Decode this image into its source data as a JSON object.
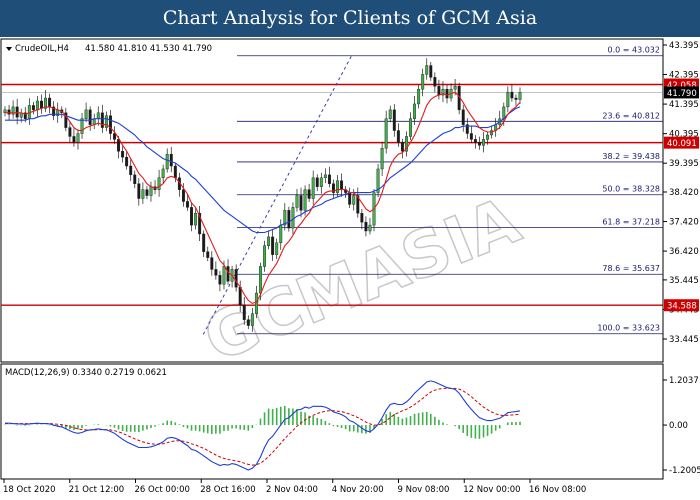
{
  "header": {
    "title": "Chart Analysis for Clients of GCM Asia"
  },
  "watermark": "GCMASIA",
  "colors": {
    "bull": "#3fb04a",
    "bear": "#1a1a1a",
    "ma_fast": "#e21b1b",
    "ma_slow": "#1f3fd6",
    "level": "#cc0000",
    "fib": "#1a1a6e",
    "trend": "#3b3bb0",
    "macd_hist": "#3fb04a",
    "macd_signal": "#cc0000",
    "macd_main": "#1f3fd6"
  },
  "chart_data": [
    {
      "type": "candlestick",
      "title": "CrudeOIL,H4",
      "ohlc_label": "41.580 41.810 41.530 41.790",
      "y_ticks": [
        "43.395",
        "42.395",
        "41.395",
        "40.395",
        "39.395",
        "38.420",
        "37.420",
        "36.420",
        "35.445",
        "34.445",
        "33.445"
      ],
      "y_range": [
        33.445,
        43.395
      ],
      "x_labels": [
        "18 Oct 2020",
        "21 Oct 12:00",
        "26 Oct 00:00",
        "28 Oct 16:00",
        "2 Nov 04:00",
        "4 Nov 20:00",
        "9 Nov 08:00",
        "12 Nov 00:00",
        "16 Nov 08:00"
      ],
      "current_price": "41.790",
      "horizontal_levels": [
        "42.058",
        "40.091",
        "34.588"
      ],
      "fibonacci": [
        {
          "label": "0.0 = 43.032",
          "value": 43.032
        },
        {
          "label": "23.6 = 40.812",
          "value": 40.812
        },
        {
          "label": "38.2 = 39.438",
          "value": 39.438
        },
        {
          "label": "50.0 = 38.328",
          "value": 38.328
        },
        {
          "label": "61.8 = 37.218",
          "value": 37.218
        },
        {
          "label": "78.6 = 35.637",
          "value": 35.637
        },
        {
          "label": "100.0 = 33.623",
          "value": 33.623
        }
      ],
      "trendline": [
        [
          33.6,
          0.385
        ],
        [
          43.1,
          0.675
        ]
      ],
      "closes": [
        41.2,
        41.05,
        41.3,
        40.95,
        41.1,
        40.9,
        41.35,
        41.2,
        41.5,
        41.25,
        41.6,
        41.3,
        41.0,
        41.2,
        41.1,
        40.6,
        40.3,
        40.1,
        40.4,
        40.9,
        41.2,
        40.7,
        40.9,
        41.1,
        40.6,
        41.0,
        40.4,
        40.2,
        39.8,
        39.6,
        39.3,
        39.0,
        38.7,
        38.2,
        38.5,
        38.3,
        38.6,
        38.5,
        38.9,
        39.2,
        39.7,
        39.3,
        38.9,
        38.5,
        38.1,
        37.9,
        37.3,
        37.7,
        37.0,
        36.4,
        36.2,
        35.8,
        35.6,
        35.3,
        35.9,
        35.4,
        35.8,
        35.2,
        34.6,
        34.1,
        33.9,
        34.3,
        35.0,
        35.9,
        36.6,
        36.9,
        36.3,
        36.7,
        37.3,
        37.8,
        37.2,
        37.9,
        38.3,
        37.8,
        38.5,
        38.2,
        38.9,
        38.6,
        38.9,
        39.0,
        38.7,
        38.4,
        38.8,
        38.5,
        38.4,
        38.0,
        38.3,
        37.7,
        37.4,
        37.1,
        37.3,
        38.4,
        39.2,
        39.9,
        40.9,
        41.2,
        40.5,
        40.1,
        39.8,
        40.3,
        40.9,
        41.4,
        41.9,
        42.4,
        42.7,
        42.3,
        42.0,
        41.7,
        41.9,
        41.6,
        41.9,
        42.0,
        41.2,
        40.7,
        40.4,
        40.2,
        40.1,
        40.0,
        40.2,
        40.35,
        40.5,
        40.7,
        40.9,
        41.3,
        41.8,
        41.6,
        41.55,
        41.79
      ],
      "ma_fast": [
        41.1,
        41.1,
        41.1,
        41.1,
        41.1,
        41.05,
        41.1,
        41.15,
        41.2,
        41.25,
        41.3,
        41.3,
        41.25,
        41.2,
        41.15,
        41.0,
        40.8,
        40.6,
        40.5,
        40.5,
        40.6,
        40.65,
        40.7,
        40.75,
        40.7,
        40.7,
        40.6,
        40.45,
        40.25,
        40.0,
        39.8,
        39.55,
        39.3,
        39.05,
        38.9,
        38.7,
        38.6,
        38.55,
        38.6,
        38.7,
        38.9,
        38.95,
        38.9,
        38.75,
        38.55,
        38.35,
        38.05,
        37.9,
        37.6,
        37.3,
        37.0,
        36.7,
        36.4,
        36.1,
        35.95,
        35.7,
        35.6,
        35.4,
        35.2,
        34.95,
        34.75,
        34.65,
        34.7,
        34.95,
        35.3,
        35.6,
        35.8,
        36.0,
        36.3,
        36.6,
        36.75,
        36.95,
        37.2,
        37.35,
        37.55,
        37.7,
        37.95,
        38.1,
        38.25,
        38.4,
        38.45,
        38.45,
        38.5,
        38.5,
        38.5,
        38.4,
        38.4,
        38.25,
        38.05,
        37.85,
        37.75,
        37.85,
        38.05,
        38.4,
        38.85,
        39.3,
        39.55,
        39.7,
        39.75,
        39.9,
        40.1,
        40.35,
        40.65,
        41.0,
        41.35,
        41.55,
        41.65,
        41.7,
        41.75,
        41.7,
        41.75,
        41.8,
        41.65,
        41.45,
        41.2,
        41.0,
        40.8,
        40.6,
        40.5,
        40.45,
        40.45,
        40.5,
        40.6,
        40.8,
        41.05,
        41.2,
        41.3,
        41.45
      ],
      "ma_slow": [
        40.85,
        40.85,
        40.85,
        40.85,
        40.85,
        40.85,
        40.9,
        40.9,
        40.95,
        41.0,
        41.0,
        41.05,
        41.05,
        41.05,
        41.05,
        41.0,
        40.95,
        40.9,
        40.85,
        40.85,
        40.85,
        40.85,
        40.9,
        40.9,
        40.9,
        40.9,
        40.85,
        40.8,
        40.75,
        40.65,
        40.55,
        40.45,
        40.35,
        40.2,
        40.1,
        39.95,
        39.85,
        39.75,
        39.65,
        39.55,
        39.5,
        39.45,
        39.4,
        39.3,
        39.2,
        39.1,
        38.95,
        38.85,
        38.7,
        38.55,
        38.4,
        38.25,
        38.1,
        37.95,
        37.8,
        37.7,
        37.6,
        37.5,
        37.4,
        37.3,
        37.2,
        37.1,
        37.05,
        37.05,
        37.05,
        37.1,
        37.15,
        37.2,
        37.3,
        37.35,
        37.4,
        37.5,
        37.6,
        37.65,
        37.75,
        37.8,
        37.9,
        37.95,
        38.0,
        38.1,
        38.15,
        38.2,
        38.25,
        38.3,
        38.35,
        38.4,
        38.4,
        38.4,
        38.4,
        38.4,
        38.4,
        38.45,
        38.5,
        38.6,
        38.75,
        38.9,
        39.0,
        39.1,
        39.2,
        39.3,
        39.4,
        39.55,
        39.7,
        39.85,
        40.0,
        40.1,
        40.2,
        40.3,
        40.4,
        40.45,
        40.5,
        40.6,
        40.6,
        40.65,
        40.65,
        40.65,
        40.65,
        40.6,
        40.6,
        40.6,
        40.65,
        40.7,
        40.8,
        40.9,
        41.05,
        41.15,
        41.25,
        41.3
      ],
      "x_count": 128
    },
    {
      "type": "macd",
      "title": "MACD(12,26,9) 0.3340 0.2719 0.0621",
      "y_ticks": [
        "1.2037",
        "0.00",
        "-1.2005"
      ],
      "y_range": [
        -1.2005,
        1.2037
      ],
      "macd_line": [
        0.05,
        0.05,
        0.04,
        0.03,
        0.03,
        0.02,
        0.03,
        0.04,
        0.05,
        0.04,
        0.04,
        0.03,
        0.0,
        -0.03,
        -0.05,
        -0.1,
        -0.15,
        -0.2,
        -0.22,
        -0.2,
        -0.15,
        -0.13,
        -0.12,
        -0.1,
        -0.12,
        -0.13,
        -0.17,
        -0.22,
        -0.3,
        -0.38,
        -0.45,
        -0.5,
        -0.55,
        -0.6,
        -0.6,
        -0.6,
        -0.58,
        -0.55,
        -0.5,
        -0.45,
        -0.35,
        -0.33,
        -0.35,
        -0.4,
        -0.48,
        -0.55,
        -0.65,
        -0.68,
        -0.75,
        -0.82,
        -0.9,
        -0.98,
        -1.03,
        -1.08,
        -1.05,
        -1.07,
        -1.03,
        -1.05,
        -1.1,
        -1.15,
        -1.2,
        -1.15,
        -1.05,
        -0.85,
        -0.6,
        -0.4,
        -0.3,
        -0.15,
        0.0,
        0.15,
        0.2,
        0.3,
        0.4,
        0.42,
        0.48,
        0.45,
        0.5,
        0.5,
        0.5,
        0.48,
        0.43,
        0.35,
        0.32,
        0.28,
        0.22,
        0.12,
        0.08,
        0.0,
        -0.08,
        -0.15,
        -0.18,
        -0.1,
        0.02,
        0.2,
        0.4,
        0.55,
        0.58,
        0.55,
        0.55,
        0.62,
        0.72,
        0.85,
        0.95,
        1.05,
        1.15,
        1.18,
        1.15,
        1.1,
        1.05,
        1.0,
        0.98,
        0.95,
        0.85,
        0.7,
        0.55,
        0.42,
        0.3,
        0.2,
        0.15,
        0.12,
        0.12,
        0.15,
        0.18,
        0.25,
        0.33,
        0.35,
        0.36,
        0.38
      ],
      "signal_line": [
        0.04,
        0.04,
        0.04,
        0.04,
        0.04,
        0.04,
        0.04,
        0.04,
        0.04,
        0.04,
        0.04,
        0.04,
        0.03,
        0.02,
        0.01,
        -0.01,
        -0.04,
        -0.07,
        -0.1,
        -0.12,
        -0.13,
        -0.13,
        -0.13,
        -0.12,
        -0.12,
        -0.12,
        -0.13,
        -0.15,
        -0.18,
        -0.22,
        -0.27,
        -0.32,
        -0.37,
        -0.41,
        -0.45,
        -0.48,
        -0.5,
        -0.51,
        -0.51,
        -0.5,
        -0.47,
        -0.44,
        -0.42,
        -0.42,
        -0.43,
        -0.46,
        -0.5,
        -0.53,
        -0.58,
        -0.62,
        -0.68,
        -0.74,
        -0.8,
        -0.85,
        -0.89,
        -0.92,
        -0.94,
        -0.96,
        -0.98,
        -1.02,
        -1.05,
        -1.07,
        -1.06,
        -1.02,
        -0.94,
        -0.84,
        -0.73,
        -0.61,
        -0.49,
        -0.36,
        -0.25,
        -0.14,
        -0.03,
        0.06,
        0.14,
        0.2,
        0.26,
        0.31,
        0.34,
        0.37,
        0.38,
        0.38,
        0.37,
        0.36,
        0.33,
        0.29,
        0.25,
        0.2,
        0.14,
        0.08,
        0.03,
        0.0,
        0.0,
        0.04,
        0.11,
        0.2,
        0.28,
        0.33,
        0.38,
        0.42,
        0.48,
        0.55,
        0.63,
        0.71,
        0.8,
        0.88,
        0.93,
        0.96,
        0.98,
        0.98,
        0.98,
        0.98,
        0.96,
        0.91,
        0.84,
        0.76,
        0.66,
        0.57,
        0.48,
        0.41,
        0.35,
        0.3,
        0.27,
        0.25,
        0.26,
        0.27,
        0.28,
        0.29
      ]
    }
  ]
}
